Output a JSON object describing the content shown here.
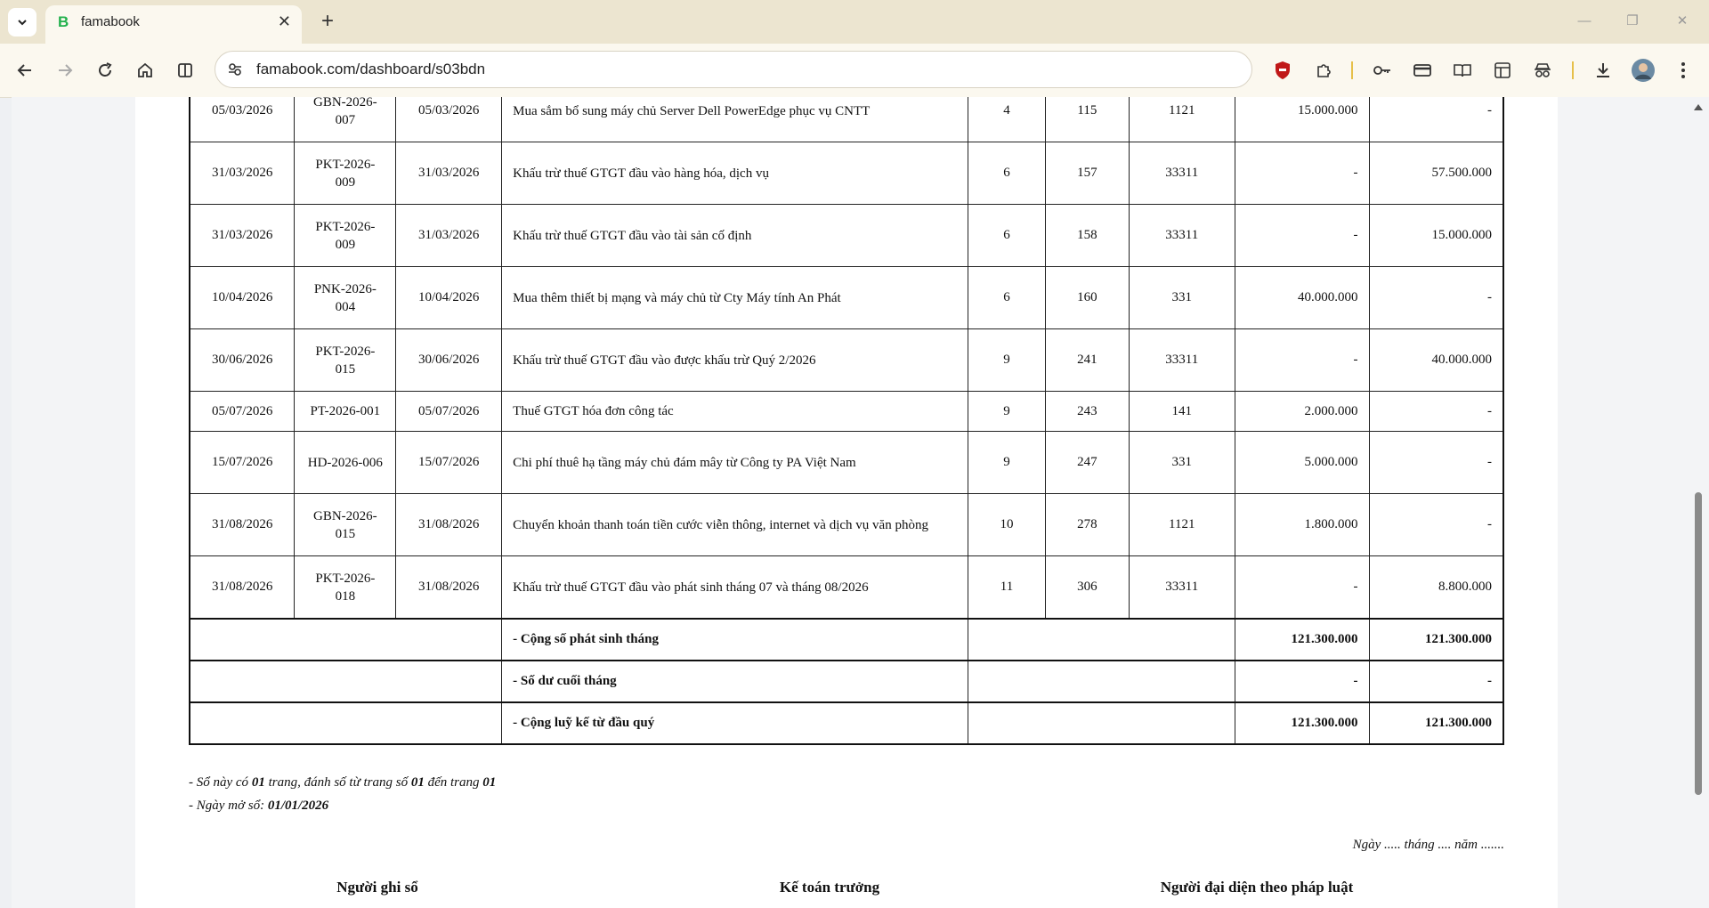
{
  "browser": {
    "tab_title": "famabook",
    "tab_favicon_letter": "B",
    "url": "famabook.com/dashboard/s03bdn"
  },
  "ledger": {
    "rows": [
      {
        "date": "05/03/2026",
        "doc_no": "GBN-2026-007",
        "doc_date": "05/03/2026",
        "desc": "Mua sắm bổ sung máy chủ Server Dell PowerEdge phục vụ CNTT",
        "page": "4",
        "line": "115",
        "acct": "1121",
        "debit": "15.000.000",
        "credit": "-"
      },
      {
        "date": "31/03/2026",
        "doc_no": "PKT-2026-009",
        "doc_date": "31/03/2026",
        "desc": "Khấu trừ thuế GTGT đầu vào hàng hóa, dịch vụ",
        "page": "6",
        "line": "157",
        "acct": "33311",
        "debit": "-",
        "credit": "57.500.000"
      },
      {
        "date": "31/03/2026",
        "doc_no": "PKT-2026-009",
        "doc_date": "31/03/2026",
        "desc": "Khấu trừ thuế GTGT đầu vào tài sản cố định",
        "page": "6",
        "line": "158",
        "acct": "33311",
        "debit": "-",
        "credit": "15.000.000"
      },
      {
        "date": "10/04/2026",
        "doc_no": "PNK-2026-004",
        "doc_date": "10/04/2026",
        "desc": "Mua thêm thiết bị mạng và máy chủ từ Cty Máy tính An Phát",
        "page": "6",
        "line": "160",
        "acct": "331",
        "debit": "40.000.000",
        "credit": "-"
      },
      {
        "date": "30/06/2026",
        "doc_no": "PKT-2026-015",
        "doc_date": "30/06/2026",
        "desc": "Khấu trừ thuế GTGT đầu vào được khấu trừ Quý 2/2026",
        "page": "9",
        "line": "241",
        "acct": "33311",
        "debit": "-",
        "credit": "40.000.000"
      },
      {
        "date": "05/07/2026",
        "doc_no": "PT-2026-001",
        "doc_date": "05/07/2026",
        "desc": "Thuế GTGT hóa đơn công tác",
        "page": "9",
        "line": "243",
        "acct": "141",
        "debit": "2.000.000",
        "credit": "-"
      },
      {
        "date": "15/07/2026",
        "doc_no": "HD-2026-006",
        "doc_date": "15/07/2026",
        "desc": "Chi phí thuê hạ tầng máy chủ đám mây từ Công ty PA Việt Nam",
        "page": "9",
        "line": "247",
        "acct": "331",
        "debit": "5.000.000",
        "credit": "-"
      },
      {
        "date": "31/08/2026",
        "doc_no": "GBN-2026-015",
        "doc_date": "31/08/2026",
        "desc": "Chuyển khoản thanh toán tiền cước viễn thông, internet và dịch vụ văn phòng",
        "page": "10",
        "line": "278",
        "acct": "1121",
        "debit": "1.800.000",
        "credit": "-"
      },
      {
        "date": "31/08/2026",
        "doc_no": "PKT-2026-018",
        "doc_date": "31/08/2026",
        "desc": "Khấu trừ thuế GTGT đầu vào phát sinh tháng 07 và tháng 08/2026",
        "page": "11",
        "line": "306",
        "acct": "33311",
        "debit": "-",
        "credit": "8.800.000"
      }
    ],
    "summary": [
      {
        "label": "- Cộng số phát sinh tháng",
        "debit": "121.300.000",
        "credit": "121.300.000"
      },
      {
        "label": "- Số dư cuối tháng",
        "debit": "-",
        "credit": "-"
      },
      {
        "label": "- Cộng luỹ kế từ đầu quý",
        "debit": "121.300.000",
        "credit": "121.300.000"
      }
    ]
  },
  "notes": {
    "line1_prefix": "- Sổ này có ",
    "line1_pages": "01",
    "line1_mid": " trang, đánh số từ trang số ",
    "line1_from": "01",
    "line1_to_label": " đến trang ",
    "line1_to": "01",
    "line2_prefix": "- Ngày mở sổ: ",
    "line2_date": "01/01/2026"
  },
  "date_line": "Ngày ..... tháng .... năm .......",
  "signers": {
    "recorder": "Người ghi sổ",
    "chief_accountant": "Kế toán trưởng",
    "legal_rep": "Người đại diện theo pháp luật"
  }
}
